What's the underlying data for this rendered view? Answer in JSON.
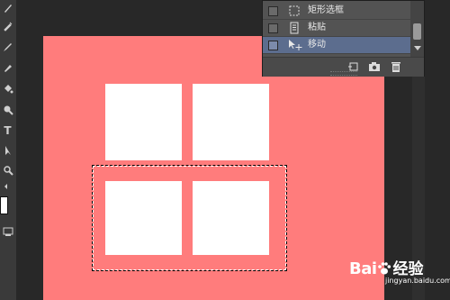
{
  "history_panel": {
    "items": [
      {
        "label": "矩形选框",
        "icon": "rectangular-marquee-icon",
        "selected": false
      },
      {
        "label": "粘贴",
        "icon": "paste-document-icon",
        "selected": false
      },
      {
        "label": "移动",
        "icon": "move-tool-icon",
        "selected": true
      }
    ],
    "footer_buttons": [
      "new-document-from-state-icon",
      "new-snapshot-icon",
      "delete-icon"
    ]
  },
  "document": {
    "background_color": "#ff7c7c",
    "square_color": "#ffffff"
  },
  "toolbar": {
    "tools": [
      "brush-icon",
      "eyedropper-icon",
      "brush-icon",
      "eraser-icon",
      "paint-bucket-icon",
      "dodge-icon",
      "pen-icon",
      "type-icon",
      "path-selection-icon",
      "zoom-icon",
      "hand-icon",
      "screen-mode-icon"
    ],
    "type_tool_label": "T"
  },
  "watermark": {
    "logo": "Bai",
    "logo_suffix": "经验",
    "url": "jingyan.baidu.com"
  }
}
